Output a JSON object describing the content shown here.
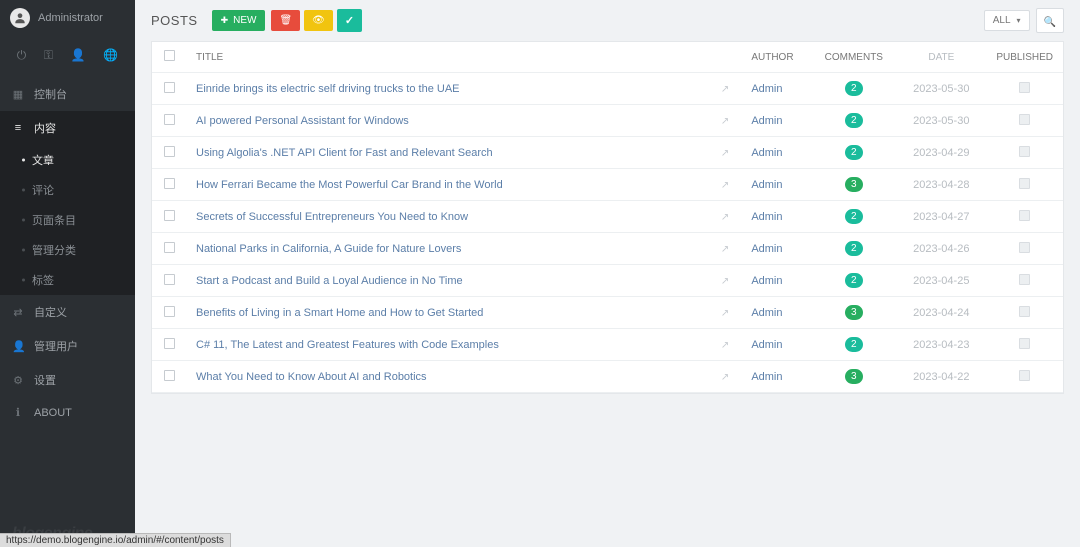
{
  "user": {
    "name": "Administrator"
  },
  "sidebar": {
    "icons": [
      "power-icon",
      "key-icon",
      "user-icon",
      "globe-icon"
    ],
    "items": [
      {
        "icon": "dashboard-icon",
        "label": "控制台"
      },
      {
        "icon": "list-icon",
        "label": "内容",
        "active": true,
        "children": [
          {
            "label": "文章",
            "selected": true
          },
          {
            "label": "评论"
          },
          {
            "label": "页面条目"
          },
          {
            "label": "管理分类"
          },
          {
            "label": "标签"
          }
        ]
      },
      {
        "icon": "custom-icon",
        "label": "自定义"
      },
      {
        "icon": "users-icon",
        "label": "管理用户"
      },
      {
        "icon": "gear-icon",
        "label": "设置"
      },
      {
        "icon": "info-icon",
        "label": "ABOUT"
      }
    ],
    "logo": "blogengine"
  },
  "toolbar": {
    "title": "POSTS",
    "new_label": "NEW",
    "filter_label": "ALL"
  },
  "table": {
    "headers": {
      "title": "TITLE",
      "author": "AUTHOR",
      "comments": "COMMENTS",
      "date": "DATE",
      "published": "PUBLISHED"
    },
    "rows": [
      {
        "title": "Einride brings its electric self driving trucks to the UAE",
        "author": "Admin",
        "comments": 2,
        "badge": "g",
        "date": "2023-05-30"
      },
      {
        "title": "AI powered Personal Assistant for Windows",
        "author": "Admin",
        "comments": 2,
        "badge": "g",
        "date": "2023-05-30"
      },
      {
        "title": "Using Algolia's .NET API Client for Fast and Relevant Search",
        "author": "Admin",
        "comments": 2,
        "badge": "g",
        "date": "2023-04-29"
      },
      {
        "title": "How Ferrari Became the Most Powerful Car Brand in the World",
        "author": "Admin",
        "comments": 3,
        "badge": "o",
        "date": "2023-04-28"
      },
      {
        "title": "Secrets of Successful Entrepreneurs You Need to Know",
        "author": "Admin",
        "comments": 2,
        "badge": "g",
        "date": "2023-04-27"
      },
      {
        "title": "National Parks in California, A Guide for Nature Lovers",
        "author": "Admin",
        "comments": 2,
        "badge": "g",
        "date": "2023-04-26"
      },
      {
        "title": "Start a Podcast and Build a Loyal Audience in No Time",
        "author": "Admin",
        "comments": 2,
        "badge": "g",
        "date": "2023-04-25"
      },
      {
        "title": "Benefits of Living in a Smart Home and How to Get Started",
        "author": "Admin",
        "comments": 3,
        "badge": "o",
        "date": "2023-04-24"
      },
      {
        "title": "C# 11, The Latest and Greatest Features with Code Examples",
        "author": "Admin",
        "comments": 2,
        "badge": "g",
        "date": "2023-04-23"
      },
      {
        "title": "What You Need to Know About AI and Robotics",
        "author": "Admin",
        "comments": 3,
        "badge": "o",
        "date": "2023-04-22"
      }
    ]
  },
  "status_url": "https://demo.blogengine.io/admin/#/content/posts"
}
